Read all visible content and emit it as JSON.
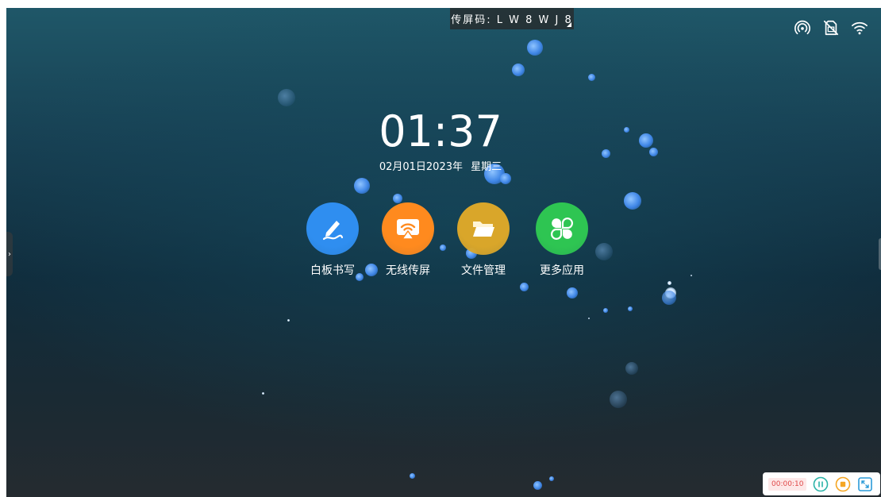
{
  "top_bar": {
    "screen_code_label": "传屏码: L W 8 W J 8"
  },
  "status_icons": [
    "hotspot-icon",
    "no-sim-icon",
    "wifi-icon"
  ],
  "clock": {
    "time": "01:37",
    "date": "02月01日2023年",
    "weekday": "星期三"
  },
  "apps": [
    {
      "label": "白板书写",
      "icon": "pen-icon",
      "color": "#2f8ef0"
    },
    {
      "label": "无线传屏",
      "icon": "cast-icon",
      "color": "#ff8a1e"
    },
    {
      "label": "文件管理",
      "icon": "folder-icon",
      "color": "#d9a62a"
    },
    {
      "label": "更多应用",
      "icon": "apps-grid-icon",
      "color": "#2ec552"
    }
  ],
  "recorder": {
    "elapsed": "00:00:10",
    "colors": {
      "pause": "#2bb3a8",
      "stop": "#f5a623",
      "expand": "#2b9bd8"
    }
  }
}
